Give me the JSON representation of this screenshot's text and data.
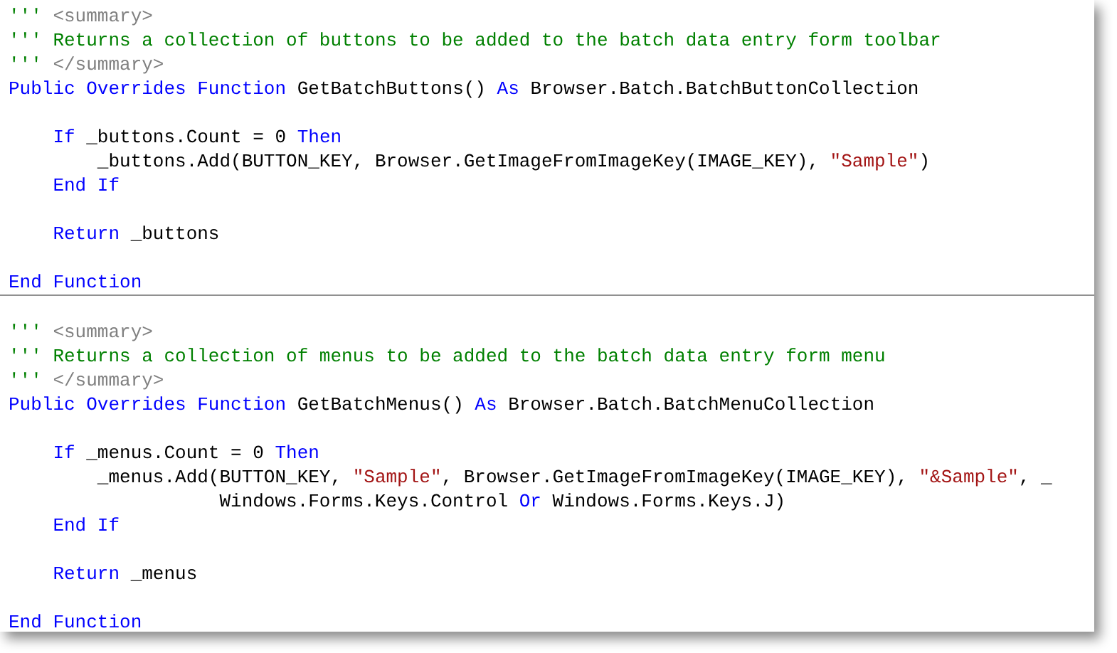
{
  "code_blocks": [
    {
      "lines": [
        {
          "kind": "code",
          "tokens": [
            {
              "kind": "comment",
              "text": "'''"
            },
            {
              "kind": "doc_tag",
              "text": " <summary>"
            }
          ]
        },
        {
          "kind": "code",
          "tokens": [
            {
              "kind": "comment",
              "text": "''' Returns a collection of buttons to be added to the batch data entry form toolbar"
            }
          ]
        },
        {
          "kind": "code",
          "tokens": [
            {
              "kind": "comment",
              "text": "'''"
            },
            {
              "kind": "doc_tag",
              "text": " </summary>"
            }
          ]
        },
        {
          "kind": "code",
          "tokens": [
            {
              "kind": "keyword",
              "text": "Public Overrides Function"
            },
            {
              "kind": "plain",
              "text": " GetBatchButtons() "
            },
            {
              "kind": "keyword",
              "text": "As"
            },
            {
              "kind": "plain",
              "text": " Browser.Batch.BatchButtonCollection"
            }
          ],
          "children": [
            {
              "kind": "blank"
            },
            {
              "kind": "code",
              "tokens": [
                {
                  "kind": "keyword",
                  "text": "If"
                },
                {
                  "kind": "plain",
                  "text": " _buttons.Count = 0 "
                },
                {
                  "kind": "keyword",
                  "text": "Then"
                }
              ],
              "children": [
                {
                  "kind": "code",
                  "tokens": [
                    {
                      "kind": "plain",
                      "text": "_buttons.Add(BUTTON_KEY, Browser.GetImageFromImageKey(IMAGE_KEY), "
                    },
                    {
                      "kind": "string",
                      "text": "\"Sample\""
                    },
                    {
                      "kind": "plain",
                      "text": ")"
                    }
                  ]
                }
              ]
            },
            {
              "kind": "code",
              "tokens": [
                {
                  "kind": "keyword",
                  "text": "End If"
                }
              ]
            },
            {
              "kind": "blank"
            },
            {
              "kind": "code",
              "tokens": [
                {
                  "kind": "keyword",
                  "text": "Return"
                },
                {
                  "kind": "plain",
                  "text": " _buttons"
                }
              ]
            },
            {
              "kind": "blank"
            }
          ]
        },
        {
          "kind": "code",
          "tokens": [
            {
              "kind": "keyword",
              "text": "End Function"
            }
          ]
        }
      ]
    },
    {
      "lines": [
        {
          "kind": "blank"
        },
        {
          "kind": "code",
          "tokens": [
            {
              "kind": "comment",
              "text": "'''"
            },
            {
              "kind": "doc_tag",
              "text": " <summary>"
            }
          ]
        },
        {
          "kind": "code",
          "tokens": [
            {
              "kind": "comment",
              "text": "''' Returns a collection of menus to be added to the batch data entry form menu"
            }
          ]
        },
        {
          "kind": "code",
          "tokens": [
            {
              "kind": "comment",
              "text": "'''"
            },
            {
              "kind": "doc_tag",
              "text": " </summary>"
            }
          ]
        },
        {
          "kind": "code",
          "tokens": [
            {
              "kind": "keyword",
              "text": "Public Overrides Function"
            },
            {
              "kind": "plain",
              "text": " GetBatchMenus() "
            },
            {
              "kind": "keyword",
              "text": "As"
            },
            {
              "kind": "plain",
              "text": " Browser.Batch.BatchMenuCollection"
            }
          ],
          "children": [
            {
              "kind": "blank"
            },
            {
              "kind": "code",
              "tokens": [
                {
                  "kind": "keyword",
                  "text": "If"
                },
                {
                  "kind": "plain",
                  "text": " _menus.Count = 0 "
                },
                {
                  "kind": "keyword",
                  "text": "Then"
                }
              ],
              "children": [
                {
                  "kind": "code",
                  "tokens": [
                    {
                      "kind": "plain",
                      "text": "_menus.Add(BUTTON_KEY, "
                    },
                    {
                      "kind": "string",
                      "text": "\"Sample\""
                    },
                    {
                      "kind": "plain",
                      "text": ", Browser.GetImageFromImageKey(IMAGE_KEY), "
                    },
                    {
                      "kind": "string",
                      "text": "\"&Sample\""
                    },
                    {
                      "kind": "plain",
                      "text": ", _"
                    }
                  ],
                  "children": [
                    {
                      "kind": "continuation",
                      "tokens": [
                        {
                          "kind": "plain",
                          "text": "Windows.Forms.Keys.Control "
                        },
                        {
                          "kind": "keyword",
                          "text": "Or"
                        },
                        {
                          "kind": "plain",
                          "text": " Windows.Forms.Keys.J)"
                        }
                      ]
                    }
                  ]
                }
              ]
            },
            {
              "kind": "code",
              "tokens": [
                {
                  "kind": "keyword",
                  "text": "End If"
                }
              ]
            },
            {
              "kind": "blank"
            },
            {
              "kind": "code",
              "tokens": [
                {
                  "kind": "keyword",
                  "text": "Return"
                },
                {
                  "kind": "plain",
                  "text": " _menus"
                }
              ]
            },
            {
              "kind": "blank"
            }
          ]
        },
        {
          "kind": "code",
          "tokens": [
            {
              "kind": "keyword",
              "text": "End Function"
            }
          ]
        }
      ]
    }
  ]
}
